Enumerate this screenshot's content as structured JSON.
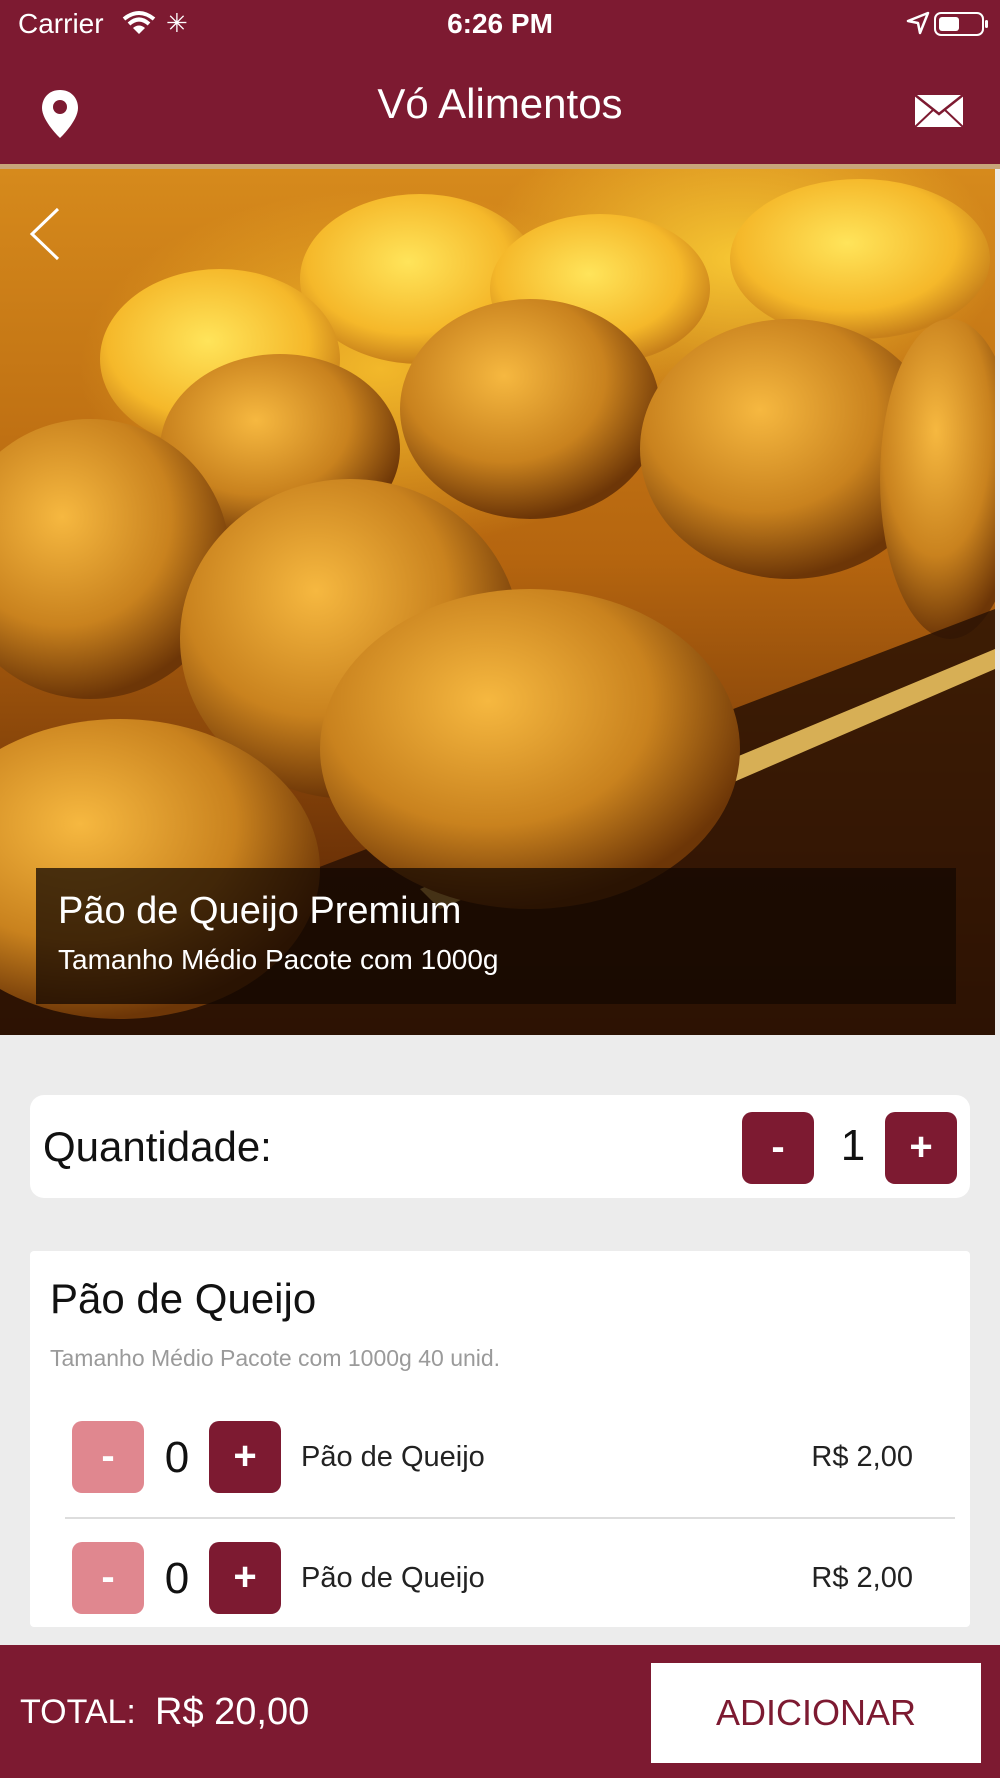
{
  "status_bar": {
    "carrier": "Carrier",
    "time": "6:26 PM"
  },
  "header": {
    "title": "Vó Alimentos",
    "left_icon": "location-pin-icon",
    "right_icon": "mail-icon"
  },
  "product": {
    "name": "Pão de Queijo Premium",
    "description": "Tamanho Médio Pacote com 1000g"
  },
  "quantity": {
    "label": "Quantidade:",
    "value": "1",
    "minus_label": "-",
    "plus_label": "+"
  },
  "options": {
    "title": "Pão de Queijo",
    "subtitle": "Tamanho Médio Pacote com 1000g 40 unid.",
    "items": [
      {
        "count": "0",
        "name": "Pão de Queijo",
        "price": "R$ 2,00",
        "minus_label": "-",
        "plus_label": "+"
      },
      {
        "count": "0",
        "name": "Pão de Queijo",
        "price": "R$ 2,00",
        "minus_label": "-",
        "plus_label": "+"
      }
    ]
  },
  "footer": {
    "total_label": "TOTAL:",
    "total_value": "R$ 20,00",
    "add_label": "ADICIONAR"
  },
  "colors": {
    "brand": "#7d1a31",
    "disabled_button": "#e0878f",
    "accent_line": "#c8a57a"
  }
}
